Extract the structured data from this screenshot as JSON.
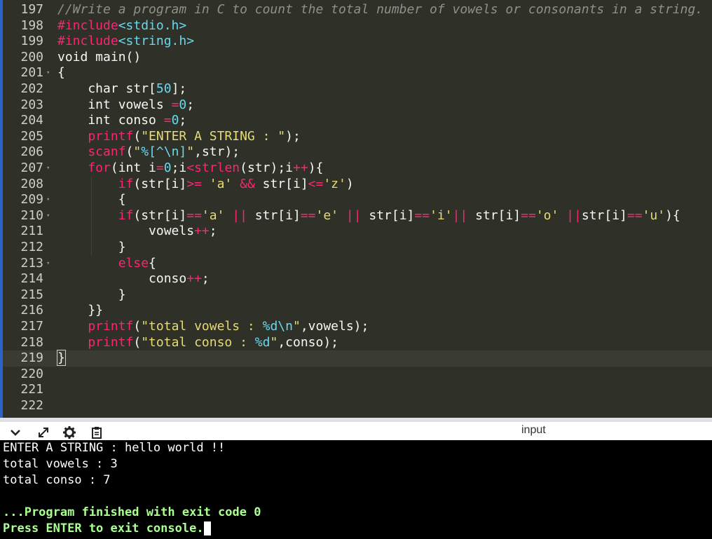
{
  "editor": {
    "lines": [
      {
        "n": "197",
        "fold": false,
        "segs": [
          [
            "c",
            "//Write a program in C to count the total number of vowels or consonants in a string."
          ]
        ]
      },
      {
        "n": "198",
        "fold": false,
        "segs": [
          [
            "p",
            "#include"
          ],
          [
            "n",
            "<stdio.h>"
          ]
        ]
      },
      {
        "n": "199",
        "fold": false,
        "segs": [
          [
            "p",
            "#include"
          ],
          [
            "n",
            "<string.h>"
          ]
        ]
      },
      {
        "n": "200",
        "fold": false,
        "segs": [
          [
            "k",
            "void main()"
          ]
        ]
      },
      {
        "n": "201",
        "fold": true,
        "segs": [
          [
            "k",
            "{"
          ]
        ]
      },
      {
        "n": "202",
        "fold": false,
        "segs": [
          [
            "k",
            "    char str["
          ],
          [
            "n",
            "50"
          ],
          [
            "k",
            "];"
          ]
        ]
      },
      {
        "n": "203",
        "fold": false,
        "segs": [
          [
            "k",
            "    int vowels "
          ],
          [
            "o",
            "="
          ],
          [
            "n",
            "0"
          ],
          [
            "k",
            ";"
          ]
        ]
      },
      {
        "n": "204",
        "fold": false,
        "segs": [
          [
            "k",
            "    int conso "
          ],
          [
            "o",
            "="
          ],
          [
            "n",
            "0"
          ],
          [
            "k",
            ";"
          ]
        ]
      },
      {
        "n": "205",
        "fold": false,
        "segs": [
          [
            "f",
            "    printf"
          ],
          [
            "k",
            "("
          ],
          [
            "s",
            "\"ENTER A STRING : \""
          ],
          [
            "k",
            ");"
          ]
        ]
      },
      {
        "n": "206",
        "fold": false,
        "segs": [
          [
            "f",
            "    scanf"
          ],
          [
            "k",
            "("
          ],
          [
            "s",
            "\""
          ],
          [
            "n",
            "%[^\\n]"
          ],
          [
            "s",
            "\""
          ],
          [
            "k",
            ",str);"
          ]
        ]
      },
      {
        "n": "207",
        "fold": true,
        "segs": [
          [
            "f",
            "    for"
          ],
          [
            "k",
            "(int i"
          ],
          [
            "o",
            "="
          ],
          [
            "n",
            "0"
          ],
          [
            "k",
            ";i"
          ],
          [
            "o",
            "<"
          ],
          [
            "f",
            "strlen"
          ],
          [
            "k",
            "(str);i"
          ],
          [
            "o",
            "++"
          ],
          [
            "k",
            "){"
          ]
        ]
      },
      {
        "n": "208",
        "fold": false,
        "segs": [
          [
            "f",
            "        if"
          ],
          [
            "k",
            "(str[i]"
          ],
          [
            "o",
            ">="
          ],
          [
            "s",
            " 'a'"
          ],
          [
            "o",
            " &&"
          ],
          [
            "k",
            " str[i]"
          ],
          [
            "o",
            "<="
          ],
          [
            "s",
            "'z'"
          ],
          [
            "k",
            ")"
          ]
        ]
      },
      {
        "n": "209",
        "fold": true,
        "segs": [
          [
            "k",
            "        {"
          ]
        ]
      },
      {
        "n": "210",
        "fold": true,
        "segs": [
          [
            "f",
            "        if"
          ],
          [
            "k",
            "(str[i]"
          ],
          [
            "o",
            "=="
          ],
          [
            "s",
            "'a'"
          ],
          [
            "o",
            " ||"
          ],
          [
            "k",
            " str[i]"
          ],
          [
            "o",
            "=="
          ],
          [
            "s",
            "'e'"
          ],
          [
            "o",
            " ||"
          ],
          [
            "k",
            " str[i]"
          ],
          [
            "o",
            "=="
          ],
          [
            "s",
            "'i'"
          ],
          [
            "o",
            "||"
          ],
          [
            "k",
            " str[i]"
          ],
          [
            "o",
            "=="
          ],
          [
            "s",
            "'o'"
          ],
          [
            "o",
            " ||"
          ],
          [
            "k",
            "str[i]"
          ],
          [
            "o",
            "=="
          ],
          [
            "s",
            "'u'"
          ],
          [
            "k",
            "){"
          ]
        ]
      },
      {
        "n": "211",
        "fold": false,
        "segs": [
          [
            "k",
            "            vowels"
          ],
          [
            "o",
            "++"
          ],
          [
            "k",
            ";"
          ]
        ]
      },
      {
        "n": "212",
        "fold": false,
        "segs": [
          [
            "k",
            "        }"
          ]
        ]
      },
      {
        "n": "213",
        "fold": true,
        "segs": [
          [
            "f",
            "        else"
          ],
          [
            "k",
            "{"
          ]
        ]
      },
      {
        "n": "214",
        "fold": false,
        "segs": [
          [
            "k",
            "            conso"
          ],
          [
            "o",
            "++"
          ],
          [
            "k",
            ";"
          ]
        ]
      },
      {
        "n": "215",
        "fold": false,
        "segs": [
          [
            "k",
            "        }"
          ]
        ]
      },
      {
        "n": "216",
        "fold": false,
        "segs": [
          [
            "k",
            "    }}"
          ]
        ]
      },
      {
        "n": "217",
        "fold": false,
        "segs": [
          [
            "f",
            "    printf"
          ],
          [
            "k",
            "("
          ],
          [
            "s",
            "\"total vowels : "
          ],
          [
            "n",
            "%d\\n"
          ],
          [
            "s",
            "\""
          ],
          [
            "k",
            ",vowels);"
          ]
        ]
      },
      {
        "n": "218",
        "fold": false,
        "segs": [
          [
            "f",
            "    printf"
          ],
          [
            "k",
            "("
          ],
          [
            "s",
            "\"total conso : "
          ],
          [
            "n",
            "%d"
          ],
          [
            "s",
            "\""
          ],
          [
            "k",
            ",conso);"
          ]
        ]
      },
      {
        "n": "219",
        "fold": false,
        "active": true,
        "segs": [
          [
            "k",
            "}"
          ]
        ]
      },
      {
        "n": "220",
        "fold": false,
        "segs": []
      },
      {
        "n": "221",
        "fold": false,
        "segs": []
      },
      {
        "n": "222",
        "fold": false,
        "segs": []
      }
    ]
  },
  "toolbar": {
    "title": "input",
    "icons": [
      "chevron-down-icon",
      "expand-icon",
      "gear-icon",
      "clipboard-icon"
    ]
  },
  "console": {
    "lines": [
      {
        "text": "ENTER A STRING : hello world !!",
        "style": "normal"
      },
      {
        "text": "total vowels : 3",
        "style": "normal"
      },
      {
        "text": "total conso : 7",
        "style": "normal"
      },
      {
        "text": "",
        "style": "normal"
      },
      {
        "text": "...Program finished with exit code 0",
        "style": "green"
      },
      {
        "text": "Press ENTER to exit console.",
        "style": "green"
      }
    ]
  }
}
